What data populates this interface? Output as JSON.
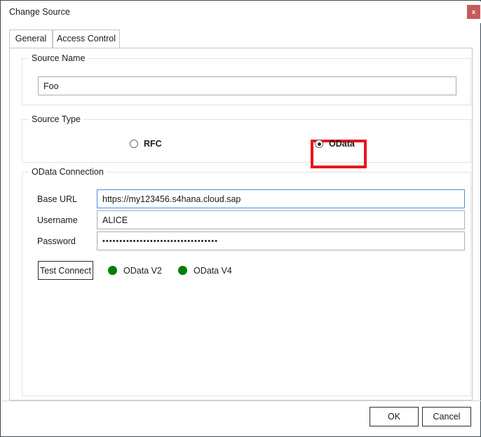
{
  "window": {
    "title": "Change Source",
    "close_label": "x"
  },
  "tabs": [
    {
      "label": "General",
      "selected": true
    },
    {
      "label": "Access Control",
      "selected": false
    }
  ],
  "source_name": {
    "caption": "Source Name",
    "value": "Foo",
    "placeholder": ""
  },
  "source_type": {
    "caption": "Source Type",
    "options": [
      {
        "label": "RFC",
        "selected": false
      },
      {
        "label": "OData",
        "selected": true
      }
    ],
    "highlight_color": "#e8161a"
  },
  "connection": {
    "caption": "OData Connection",
    "fields": [
      {
        "label": "Base URL",
        "value": "https://my123456.s4hana.cloud.sap",
        "focused": true
      },
      {
        "label": "Username",
        "value": "ALICE",
        "focused": false
      },
      {
        "label": "Password",
        "value": "••••••••••••••••••••••••••••••••••",
        "focused": false
      }
    ],
    "test_button_label": "Test Connect",
    "status": [
      {
        "label": "OData V2",
        "color": "#008000"
      },
      {
        "label": "OData V4",
        "color": "#008000"
      }
    ]
  },
  "footer": {
    "ok_label": "OK",
    "cancel_label": "Cancel"
  }
}
